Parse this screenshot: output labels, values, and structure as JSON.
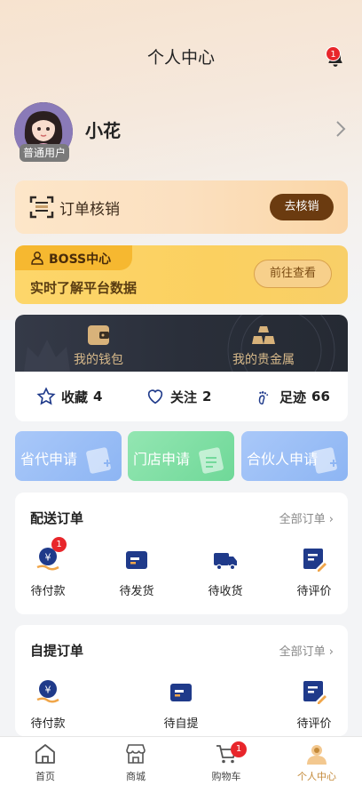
{
  "header": {
    "title": "个人中心",
    "notification_count": "1"
  },
  "profile": {
    "name": "小花",
    "role_tag": "普通用户"
  },
  "verify": {
    "title": "订单核销",
    "button": "去核销"
  },
  "boss": {
    "tab_label": "BOSS中心",
    "subtitle": "实时了解平台数据",
    "button": "前往查看"
  },
  "wallet": {
    "items": [
      {
        "label": "我的钱包"
      },
      {
        "label": "我的贵金属"
      }
    ],
    "stats": [
      {
        "label": "收藏",
        "count": "4"
      },
      {
        "label": "关注",
        "count": "2"
      },
      {
        "label": "足迹",
        "count": "66"
      }
    ]
  },
  "apply": [
    {
      "label": "省代申请",
      "color": "#9cc0f7"
    },
    {
      "label": "门店申请",
      "color": "#84e0a8"
    },
    {
      "label": "合伙人申请",
      "color": "#9cc0f7"
    }
  ],
  "delivery_orders": {
    "title": "配送订单",
    "all_label": "全部订单",
    "items": [
      {
        "label": "待付款",
        "icon": "payment-icon",
        "badge": "1"
      },
      {
        "label": "待发货",
        "icon": "to-ship-icon"
      },
      {
        "label": "待收货",
        "icon": "truck-icon"
      },
      {
        "label": "待评价",
        "icon": "review-icon"
      }
    ]
  },
  "pickup_orders": {
    "title": "自提订单",
    "all_label": "全部订单",
    "items": [
      {
        "label": "待付款",
        "icon": "payment-icon"
      },
      {
        "label": "待自提",
        "icon": "pickup-icon"
      },
      {
        "label": "待评价",
        "icon": "review-icon"
      }
    ]
  },
  "tabbar": {
    "items": [
      {
        "label": "首页",
        "icon": "home-icon"
      },
      {
        "label": "商城",
        "icon": "store-icon"
      },
      {
        "label": "购物车",
        "icon": "cart-icon",
        "badge": "1"
      },
      {
        "label": "个人中心",
        "icon": "user-icon",
        "active": true
      }
    ]
  },
  "colors": {
    "accent": "#c48a3a",
    "icon_navy": "#1f3a8a",
    "badge_red": "#e8262b"
  }
}
